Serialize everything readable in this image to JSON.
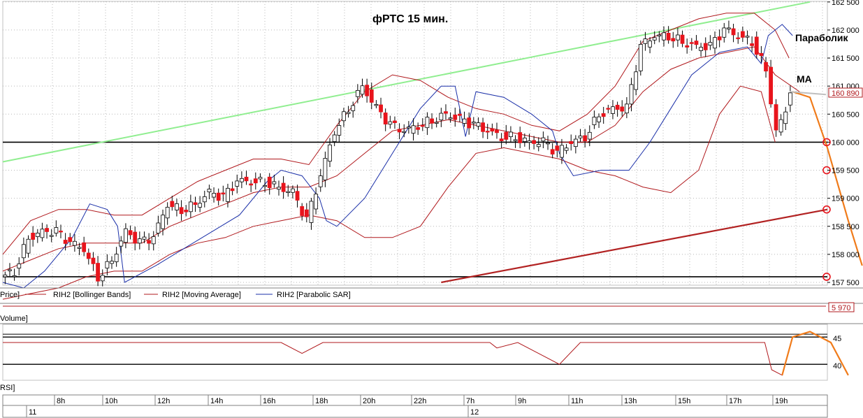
{
  "title": "фРТС   15 мин.",
  "annotations": {
    "parabolic": "Параболик",
    "ma": "MA"
  },
  "price_panel": {
    "legend": {
      "price": "Price]",
      "bollinger": "RIH2 [Bollinger Bands]",
      "moving_average": "RIH2 [Moving Average]",
      "parabolic_sar": "RIH2 [Parabolic SAR]"
    },
    "last_price_label": "160 890",
    "y_ticks": [
      "162 500",
      "162 000",
      "161 500",
      "161 000",
      "160 500",
      "160 000",
      "159 500",
      "159 000",
      "158 500",
      "158 000",
      "157 500"
    ]
  },
  "volume_panel": {
    "label": "Volume]",
    "value_label": "5 970"
  },
  "rsi_panel": {
    "label": "RSI]",
    "y_ticks": [
      "45",
      "40"
    ]
  },
  "time_axis": {
    "hours": [
      "8h",
      "10h",
      "12h",
      "14h",
      "16h",
      "18h",
      "20h",
      "22h",
      "7h",
      "9h",
      "11h",
      "13h",
      "15h",
      "17h",
      "19h"
    ],
    "days": [
      "11",
      "12"
    ]
  },
  "colors": {
    "up_candle": "#ffffff",
    "down_candle": "#e8141c",
    "indicator_red": "#b0181c",
    "sar_blue": "#1a2fa8",
    "trend_green": "#90ee90",
    "trend_red": "#b22222",
    "forecast_orange": "#f07b1a",
    "level_line": "#000000",
    "grid": "#b8b8b8"
  },
  "chart_data": {
    "type": "line",
    "price_series": [
      [
        0,
        157600
      ],
      [
        20,
        157700
      ],
      [
        40,
        158300
      ],
      [
        60,
        158400
      ],
      [
        80,
        158400
      ],
      [
        100,
        158200
      ],
      [
        120,
        158100
      ],
      [
        140,
        157600
      ],
      [
        160,
        157900
      ],
      [
        180,
        158400
      ],
      [
        200,
        158200
      ],
      [
        220,
        158300
      ],
      [
        240,
        158900
      ],
      [
        260,
        158800
      ],
      [
        280,
        158900
      ],
      [
        300,
        159100
      ],
      [
        320,
        159000
      ],
      [
        340,
        159300
      ],
      [
        360,
        159300
      ],
      [
        380,
        159300
      ],
      [
        400,
        159200
      ],
      [
        420,
        159100
      ],
      [
        440,
        158600
      ],
      [
        460,
        159400
      ],
      [
        480,
        160200
      ],
      [
        500,
        160600
      ],
      [
        520,
        161000
      ],
      [
        540,
        160600
      ],
      [
        560,
        160300
      ],
      [
        580,
        160200
      ],
      [
        600,
        160300
      ],
      [
        620,
        160400
      ],
      [
        640,
        160500
      ],
      [
        660,
        160400
      ],
      [
        680,
        160300
      ],
      [
        700,
        160200
      ],
      [
        720,
        160100
      ],
      [
        740,
        160100
      ],
      [
        760,
        160000
      ],
      [
        780,
        160000
      ],
      [
        800,
        159800
      ],
      [
        820,
        160000
      ],
      [
        840,
        160100
      ],
      [
        860,
        160500
      ],
      [
        880,
        160600
      ],
      [
        900,
        160600
      ],
      [
        920,
        161700
      ],
      [
        940,
        161900
      ],
      [
        960,
        161900
      ],
      [
        980,
        161800
      ],
      [
        1000,
        161700
      ],
      [
        1020,
        161700
      ],
      [
        1040,
        162000
      ],
      [
        1060,
        161900
      ],
      [
        1080,
        161800
      ],
      [
        1100,
        161300
      ],
      [
        1115,
        160200
      ],
      [
        1135,
        160800
      ]
    ],
    "moving_average": [
      [
        0,
        157700
      ],
      [
        40,
        157900
      ],
      [
        80,
        158100
      ],
      [
        120,
        158200
      ],
      [
        160,
        158200
      ],
      [
        200,
        158200
      ],
      [
        240,
        158500
      ],
      [
        280,
        158700
      ],
      [
        320,
        158900
      ],
      [
        360,
        159100
      ],
      [
        400,
        159200
      ],
      [
        440,
        159200
      ],
      [
        480,
        159400
      ],
      [
        520,
        159800
      ],
      [
        560,
        160200
      ],
      [
        600,
        160300
      ],
      [
        640,
        160400
      ],
      [
        680,
        160300
      ],
      [
        720,
        160200
      ],
      [
        760,
        160100
      ],
      [
        800,
        160000
      ],
      [
        840,
        160000
      ],
      [
        880,
        160300
      ],
      [
        920,
        160900
      ],
      [
        960,
        161300
      ],
      [
        1000,
        161500
      ],
      [
        1040,
        161600
      ],
      [
        1080,
        161700
      ],
      [
        1110,
        161200
      ],
      [
        1145,
        160900
      ]
    ],
    "bollinger_upper": [
      [
        0,
        158000
      ],
      [
        40,
        158600
      ],
      [
        80,
        158800
      ],
      [
        120,
        158800
      ],
      [
        160,
        158700
      ],
      [
        200,
        158700
      ],
      [
        240,
        159000
      ],
      [
        280,
        159300
      ],
      [
        320,
        159500
      ],
      [
        360,
        159700
      ],
      [
        400,
        159700
      ],
      [
        440,
        159600
      ],
      [
        480,
        160300
      ],
      [
        520,
        160900
      ],
      [
        560,
        161200
      ],
      [
        600,
        161100
      ],
      [
        640,
        160800
      ],
      [
        680,
        160600
      ],
      [
        720,
        160500
      ],
      [
        760,
        160300
      ],
      [
        800,
        160200
      ],
      [
        840,
        160500
      ],
      [
        880,
        161000
      ],
      [
        920,
        161800
      ],
      [
        960,
        162000
      ],
      [
        1000,
        162200
      ],
      [
        1040,
        162300
      ],
      [
        1080,
        162300
      ],
      [
        1110,
        162000
      ],
      [
        1130,
        161500
      ]
    ],
    "bollinger_lower": [
      [
        0,
        157200
      ],
      [
        40,
        157300
      ],
      [
        80,
        157400
      ],
      [
        120,
        157600
      ],
      [
        160,
        157700
      ],
      [
        200,
        157700
      ],
      [
        240,
        158000
      ],
      [
        280,
        158200
      ],
      [
        320,
        158300
      ],
      [
        360,
        158500
      ],
      [
        400,
        158600
      ],
      [
        440,
        158700
      ],
      [
        480,
        158600
      ],
      [
        520,
        158300
      ],
      [
        560,
        158300
      ],
      [
        600,
        158500
      ],
      [
        640,
        159200
      ],
      [
        680,
        159800
      ],
      [
        720,
        159900
      ],
      [
        760,
        159800
      ],
      [
        800,
        159700
      ],
      [
        840,
        159500
      ],
      [
        880,
        159400
      ],
      [
        920,
        159200
      ],
      [
        960,
        159100
      ],
      [
        1000,
        159500
      ],
      [
        1030,
        160500
      ],
      [
        1060,
        161000
      ],
      [
        1090,
        160900
      ],
      [
        1110,
        160000
      ]
    ],
    "parabolic_sar": [
      [
        0,
        157500
      ],
      [
        30,
        157400
      ],
      [
        60,
        157700
      ],
      [
        100,
        158300
      ],
      [
        125,
        158900
      ],
      [
        150,
        158800
      ],
      [
        165,
        158500
      ],
      [
        175,
        157500
      ],
      [
        220,
        157800
      ],
      [
        260,
        158100
      ],
      [
        300,
        158400
      ],
      [
        340,
        158700
      ],
      [
        380,
        159300
      ],
      [
        400,
        159500
      ],
      [
        430,
        159400
      ],
      [
        455,
        159000
      ],
      [
        465,
        158600
      ],
      [
        480,
        158500
      ],
      [
        520,
        159000
      ],
      [
        560,
        159800
      ],
      [
        600,
        160600
      ],
      [
        630,
        161000
      ],
      [
        650,
        161000
      ],
      [
        665,
        160100
      ],
      [
        680,
        160900
      ],
      [
        720,
        160800
      ],
      [
        760,
        160500
      ],
      [
        790,
        160200
      ],
      [
        800,
        159800
      ],
      [
        820,
        159400
      ],
      [
        860,
        159500
      ],
      [
        900,
        159500
      ],
      [
        930,
        160000
      ],
      [
        960,
        160600
      ],
      [
        990,
        161200
      ],
      [
        1030,
        161600
      ],
      [
        1070,
        161700
      ],
      [
        1090,
        161400
      ],
      [
        1100,
        161900
      ],
      [
        1120,
        162100
      ],
      [
        1135,
        161900
      ]
    ],
    "levels": [
      160000,
      157600
    ],
    "trend_lines": [
      {
        "x": [
          0,
          1160
        ],
        "y": [
          159650,
          162500
        ]
      },
      {
        "x": [
          630,
          1185
        ],
        "y": [
          157500,
          158800
        ]
      }
    ],
    "forecast": [
      [
        1135,
        160900
      ],
      [
        1160,
        160800
      ],
      [
        1185,
        159900
      ],
      [
        1215,
        158600
      ],
      [
        1235,
        157800
      ]
    ],
    "forecast_markers": [
      160000,
      159500,
      158800,
      157600
    ],
    "rsi": [
      [
        0,
        44
      ],
      [
        200,
        44
      ],
      [
        400,
        44
      ],
      [
        430,
        42
      ],
      [
        460,
        44
      ],
      [
        700,
        44
      ],
      [
        710,
        43
      ],
      [
        740,
        44
      ],
      [
        800,
        40
      ],
      [
        830,
        44
      ],
      [
        1095,
        44
      ],
      [
        1105,
        39
      ],
      [
        1120,
        38
      ],
      [
        1135,
        45
      ],
      [
        1160,
        46
      ],
      [
        1190,
        44
      ],
      [
        1215,
        38
      ]
    ],
    "rsi_levels": [
      45,
      40
    ],
    "y_range": [
      157400,
      162600
    ],
    "x_range": [
      0,
      1185
    ],
    "x_unit": "time_index"
  }
}
